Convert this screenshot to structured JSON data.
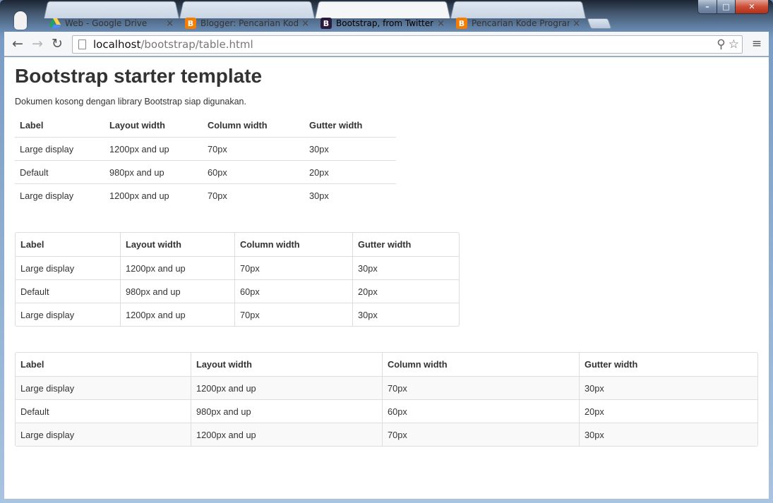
{
  "browser": {
    "tabs": [
      {
        "title": "Web - Google Drive",
        "favicon": "google-drive-icon",
        "active": false
      },
      {
        "title": "Blogger: Pencarian Kode P",
        "favicon": "blogger-icon",
        "active": false
      },
      {
        "title": "Bootstrap, from Twitter",
        "favicon": "bootstrap-icon",
        "active": true
      },
      {
        "title": "Pencarian Kode Program,",
        "favicon": "blogger-icon",
        "active": false
      }
    ],
    "close_glyph": "×",
    "url_host": "localhost",
    "url_path": "/bootstrap/table.html",
    "icons": {
      "back": "←",
      "forward": "→",
      "reload": "↻",
      "search": "⚲",
      "star": "☆",
      "menu": "≡"
    },
    "window_controls": {
      "minimize": "–",
      "maximize": "□",
      "close": "✕"
    }
  },
  "page": {
    "title": "Bootstrap starter template",
    "lead": "Dokumen kosong dengan library Bootstrap siap digunakan."
  },
  "tables": [
    {
      "headers": [
        "Label",
        "Layout width",
        "Column width",
        "Gutter width"
      ],
      "rows": [
        [
          "Large display",
          "1200px and up",
          "70px",
          "30px"
        ],
        [
          "Default",
          "980px and up",
          "60px",
          "20px"
        ],
        [
          "Large display",
          "1200px and up",
          "70px",
          "30px"
        ]
      ]
    },
    {
      "headers": [
        "Label",
        "Layout width",
        "Column width",
        "Gutter width"
      ],
      "rows": [
        [
          "Large display",
          "1200px and up",
          "70px",
          "30px"
        ],
        [
          "Default",
          "980px and up",
          "60px",
          "20px"
        ],
        [
          "Large display",
          "1200px and up",
          "70px",
          "30px"
        ]
      ]
    },
    {
      "headers": [
        "Label",
        "Layout width",
        "Column width",
        "Gutter width"
      ],
      "rows": [
        [
          "Large display",
          "1200px and up",
          "70px",
          "30px"
        ],
        [
          "Default",
          "980px and up",
          "60px",
          "20px"
        ],
        [
          "Large display",
          "1200px and up",
          "70px",
          "30px"
        ]
      ]
    }
  ],
  "colors": {
    "blogger": "#f57d00",
    "bootstrap": "#2b1a3d",
    "drive_green": "#1da462",
    "drive_yellow": "#ffd04b",
    "drive_blue": "#4c8bf5"
  }
}
